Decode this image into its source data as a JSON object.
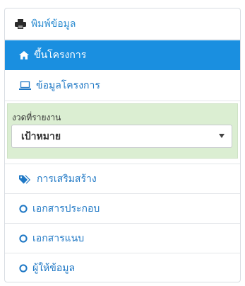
{
  "menu": {
    "print": {
      "label": "พิมพ์ข้อมูล",
      "icon": "printer-icon"
    },
    "items": [
      {
        "label": "ขึ้นโครงการ",
        "icon": "home-icon",
        "active": true
      },
      {
        "label": "ข้อมูลโครงการ",
        "icon": "laptop-icon",
        "active": false
      }
    ]
  },
  "period": {
    "label": "งวดที่รายงาน",
    "selected": "เป้าหมาย"
  },
  "sub_items": [
    {
      "label": "การเสริมสร้าง",
      "icon": "tags-icon"
    },
    {
      "label": "เอกสารประกอบ",
      "icon": "circle-icon"
    },
    {
      "label": "เอกสารแนบ",
      "icon": "circle-icon"
    },
    {
      "label": "ผู้ให้ข้อมูล",
      "icon": "circle-icon"
    }
  ],
  "colors": {
    "link": "#1f78c5",
    "active_bg": "#1a8fe0",
    "period_bg": "#dbeed2"
  }
}
